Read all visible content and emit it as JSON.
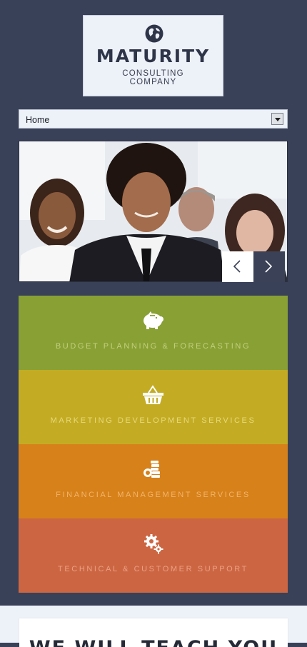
{
  "logo": {
    "brand": "MATURITY",
    "line1": "CONSULTING",
    "line2": "COMPANY",
    "icon": "globe-icon"
  },
  "nav": {
    "selected": "Home"
  },
  "slider": {
    "prev_icon": "chevron-left-icon",
    "next_icon": "chevron-right-icon"
  },
  "services": [
    {
      "label": "BUDGET PLANNING & FORECASTING",
      "icon": "piggy-bank-icon",
      "color": "#88a034"
    },
    {
      "label": "MARKETING DEVELOPMENT SERVICES",
      "icon": "shopping-basket-icon",
      "color": "#c3ac23"
    },
    {
      "label": "FINANCIAL MANAGEMENT SERVICES",
      "icon": "coins-icon",
      "color": "#d7811a"
    },
    {
      "label": "TECHNICAL & CUSTOMER SUPPORT",
      "icon": "gears-icon",
      "color": "#cc6642"
    }
  ],
  "lower": {
    "heading": "WE WILL TEACH YOU"
  }
}
